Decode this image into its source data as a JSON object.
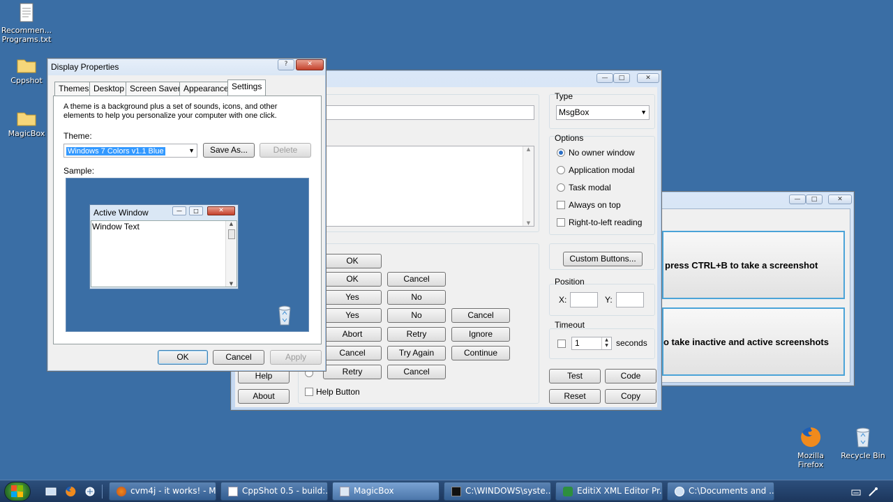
{
  "desktop": {
    "icons": [
      {
        "label": "Recommen...\nPrograms.txt",
        "icon": "text-file-icon"
      },
      {
        "label": "Cppshot",
        "icon": "folder-icon"
      },
      {
        "label": "MagicBox",
        "icon": "folder-icon"
      },
      {
        "label": "Mozilla\nFirefox",
        "icon": "firefox-icon"
      },
      {
        "label": "Recycle Bin",
        "icon": "recycle-bin-icon"
      }
    ]
  },
  "display_properties": {
    "title": "Display Properties",
    "help_label": "?",
    "close_label": "✕",
    "tabs": [
      "Themes",
      "Desktop",
      "Screen Saver",
      "Appearance",
      "Settings"
    ],
    "description": "A theme is a background plus a set of sounds, icons, and other elements to help you personalize your computer with one click.",
    "theme_label": "Theme:",
    "theme_value": "Windows 7 Colors v1.1 Blue",
    "save_as": "Save As...",
    "delete": "Delete",
    "sample_label": "Sample:",
    "sample_window_title": "Active Window",
    "sample_window_text": "Window Text",
    "ok": "OK",
    "cancel": "Cancel",
    "apply": "Apply"
  },
  "magicbox": {
    "type_label": "Type",
    "type_value": "MsgBox",
    "options_label": "Options",
    "options": [
      {
        "label": "No owner window",
        "checked": true,
        "kind": "radio"
      },
      {
        "label": "Application modal",
        "checked": false,
        "kind": "radio"
      },
      {
        "label": "Task modal",
        "checked": false,
        "kind": "radio"
      },
      {
        "label": "Always on top",
        "checked": false,
        "kind": "checkbox"
      },
      {
        "label": "Right-to-left reading",
        "checked": false,
        "kind": "checkbox"
      }
    ],
    "custom_buttons": "Custom Buttons...",
    "position_label": "Position",
    "x_label": "X:",
    "y_label": "Y:",
    "timeout_label": "Timeout",
    "timeout_value": "1",
    "seconds_label": "seconds",
    "button_rows": [
      [
        "OK"
      ],
      [
        "OK",
        "Cancel"
      ],
      [
        "Yes",
        "No"
      ],
      [
        "Yes",
        "No",
        "Cancel"
      ],
      [
        "Abort",
        "Retry",
        "Ignore"
      ],
      [
        "Cancel",
        "Try Again",
        "Continue"
      ],
      [
        "Retry",
        "Cancel"
      ]
    ],
    "help": "Help",
    "about": "About",
    "help_button_label": "Help Button",
    "test": "Test",
    "code": "Code",
    "reset": "Reset",
    "copy": "Copy"
  },
  "cppshot": {
    "line1": "press CTRL+B to take a screenshot",
    "line2": "o take inactive and active screenshots"
  },
  "taskbar": {
    "items": [
      {
        "label": "cvm4j - it works! - M...",
        "icon": "firefox-icon"
      },
      {
        "label": "CppShot 0.5 - build:...",
        "icon": "window-icon"
      },
      {
        "label": "MagicBox",
        "icon": "window-icon"
      },
      {
        "label": "C:\\WINDOWS\\syste...",
        "icon": "console-icon"
      },
      {
        "label": "EditiX XML Editor Pr...",
        "icon": "editix-icon"
      },
      {
        "label": "C:\\Documents and ...",
        "icon": "explorer-icon"
      }
    ]
  },
  "colors": {
    "desktop": "#3a6ea5",
    "sample_bg": "#3a6ea5",
    "selection": "#3399ff"
  }
}
